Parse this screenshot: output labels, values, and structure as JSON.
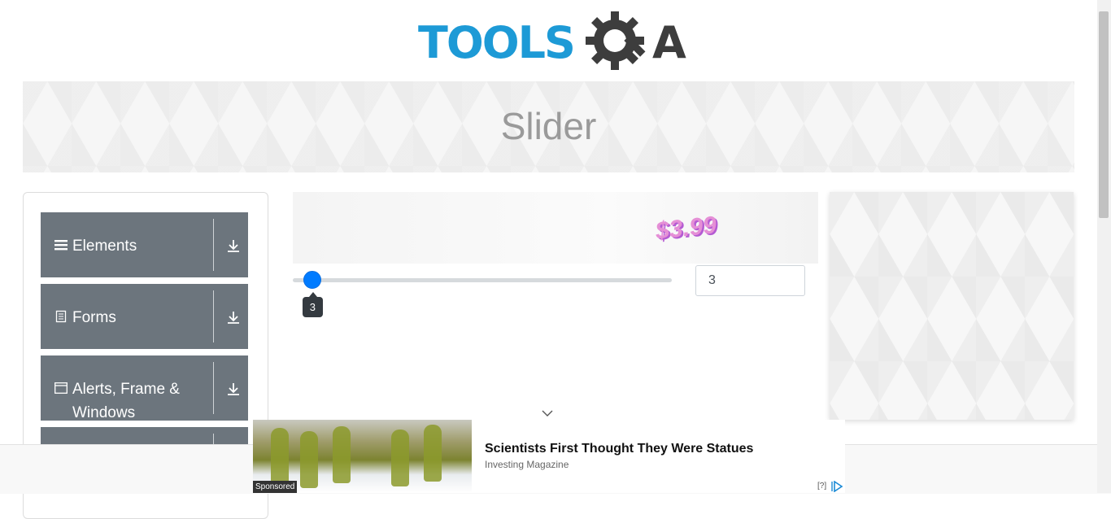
{
  "header": {
    "logo_text": "TOOLS",
    "logo_suffix": "A"
  },
  "banner": {
    "title": "Slider"
  },
  "sidebar": {
    "groups": [
      {
        "label": "Elements",
        "icon": "hamburger-icon"
      },
      {
        "label": "Forms",
        "icon": "document-icon"
      },
      {
        "label": "Alerts, Frame & Windows",
        "icon": "window-icon"
      },
      {
        "label": "",
        "icon": ""
      }
    ]
  },
  "main": {
    "promo_price": "$3.99",
    "slider": {
      "value": 3,
      "min": 0,
      "max": 100,
      "tooltip": "3",
      "input_value": "3"
    }
  },
  "ad": {
    "title": "Scientists First Thought They Were Statues",
    "source": "Investing Magazine",
    "sponsored": "Sponsored",
    "info": "[?]"
  },
  "colors": {
    "accent": "#007bff",
    "sidebar_bg": "#6c757d",
    "logo_blue": "#1d9ad6"
  }
}
